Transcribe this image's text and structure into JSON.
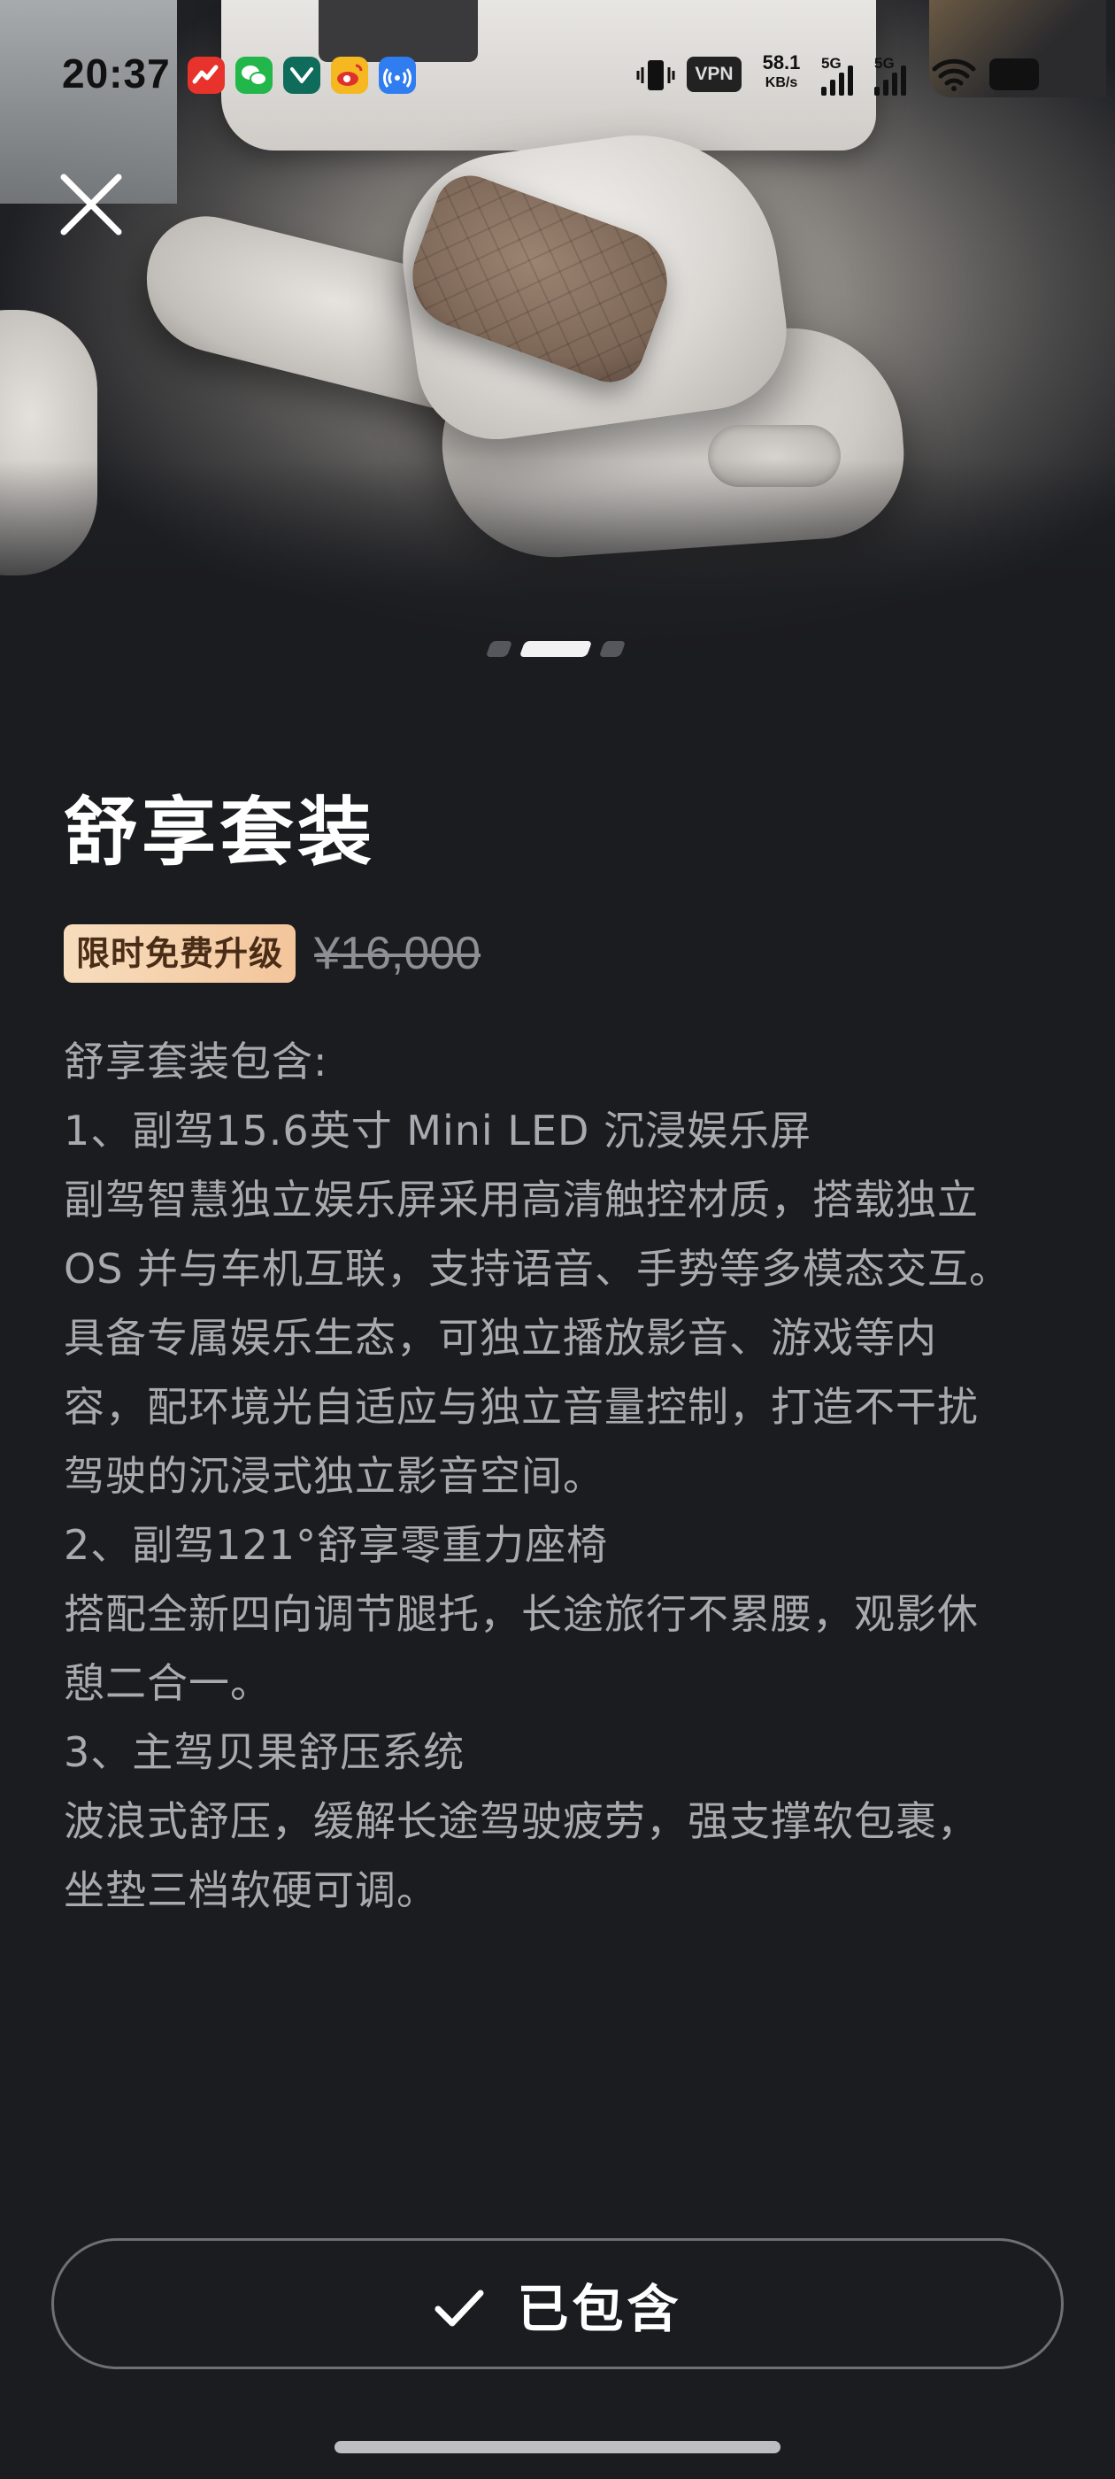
{
  "status_bar": {
    "time": "20:37",
    "vpn": "VPN",
    "net_speed_value": "58.1",
    "net_speed_unit": "KB/s",
    "sim1": "5G",
    "sim2": "5G",
    "app_icons": [
      "stock-app-icon",
      "wechat-icon",
      "mail-app-icon",
      "weibo-icon",
      "broadcast-icon"
    ]
  },
  "package": {
    "title": "舒享套装",
    "promo_badge": "限时免费升级",
    "original_price": "¥16,000",
    "description_lines": [
      "舒享套装包含:",
      "1、副驾15.6英寸 Mini LED 沉浸娱乐屏",
      "副驾智慧独立娱乐屏采用高清触控材质，搭载独立",
      "OS 并与车机互联，支持语音、手势等多模态交互。",
      "具备专属娱乐生态，可独立播放影音、游戏等内",
      "容，配环境光自适应与独立音量控制，打造不干扰",
      "驾驶的沉浸式独立影音空间。",
      "2、副驾121°舒享零重力座椅",
      "搭配全新四向调节腿托，长途旅行不累腰，观影休",
      "憩二合一。",
      "3、主驾贝果舒压系统",
      "波浪式舒压，缓解长途驾驶疲劳，强支撑软包裹，",
      "坐垫三档软硬可调。"
    ]
  },
  "carousel": {
    "page_count": 3,
    "active_index": 1
  },
  "footer": {
    "included_label": "已包含"
  },
  "colors": {
    "background": "#1b1c20",
    "promo_badge_bg": "#f3c59b",
    "promo_badge_text": "#4a2d17",
    "muted_text": "#a8aaaf"
  }
}
